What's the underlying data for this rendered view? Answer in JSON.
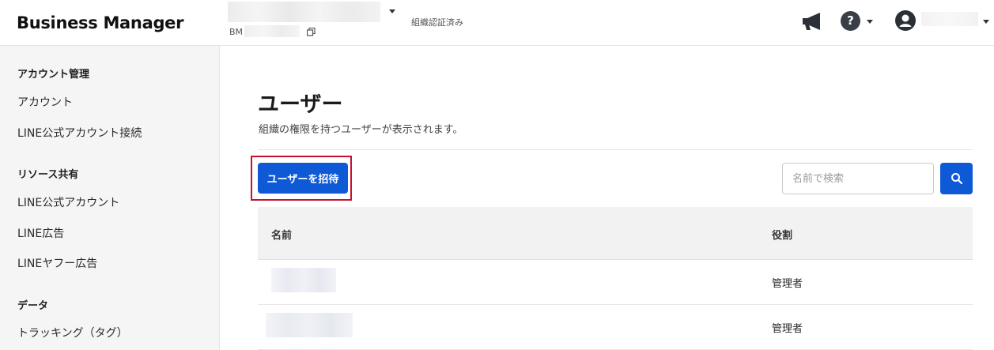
{
  "header": {
    "brand": "Business Manager",
    "bm_prefix": "BM",
    "verified_label": "組織認証済み"
  },
  "sidebar": {
    "sections": [
      {
        "title": "アカウント管理",
        "items": [
          "アカウント",
          "LINE公式アカウント接続"
        ]
      },
      {
        "title": "リソース共有",
        "items": [
          "LINE公式アカウント",
          "LINE広告",
          "LINEヤフー広告"
        ]
      },
      {
        "title": "データ",
        "items": [
          "トラッキング（タグ）"
        ]
      }
    ]
  },
  "main": {
    "title": "ユーザー",
    "description": "組織の権限を持つユーザーが表示されます。",
    "invite_button": "ユーザーを招待",
    "search_placeholder": "名前で検索",
    "table": {
      "headers": {
        "name": "名前",
        "role": "役割"
      },
      "rows": [
        {
          "role": "管理者"
        },
        {
          "role": "管理者"
        }
      ]
    }
  },
  "colors": {
    "primary": "#0e5ad6",
    "highlight": "#c8102e"
  },
  "icons": [
    "copy-icon",
    "megaphone-icon",
    "help-icon",
    "chevron-down-icon",
    "avatar-icon",
    "search-icon"
  ]
}
